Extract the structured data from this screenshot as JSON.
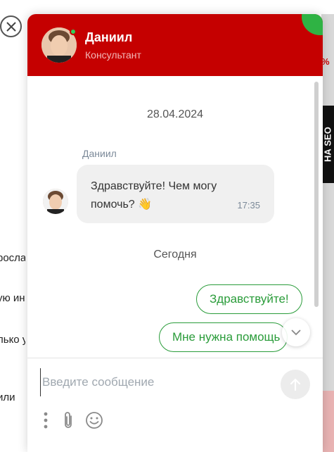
{
  "background_page": {
    "text_fragments": [
      "росла",
      "ую ин",
      "лько у",
      "или"
    ],
    "side_banner": "НА SEO",
    "side_percent": "%"
  },
  "header": {
    "agent_name": "Даниил",
    "agent_role": "Консультант",
    "accent_color": "#c50000",
    "online_color": "#2fd15a"
  },
  "chat": {
    "date_separator": "28.04.2024",
    "today_separator": "Сегодня",
    "incoming": {
      "author": "Даниил",
      "text": "Здравствуйте! Чем могу помочь? 👋",
      "time": "17:35"
    },
    "outgoing": [
      {
        "text": "Здравствуйте!"
      },
      {
        "text": "Мне нужна помощь"
      }
    ]
  },
  "composer": {
    "placeholder": "Введите сообщение",
    "value": ""
  },
  "icons": [
    "close-icon",
    "chevron-down-icon",
    "send-arrow-icon",
    "more-vertical-icon",
    "paperclip-icon",
    "smiley-icon"
  ]
}
